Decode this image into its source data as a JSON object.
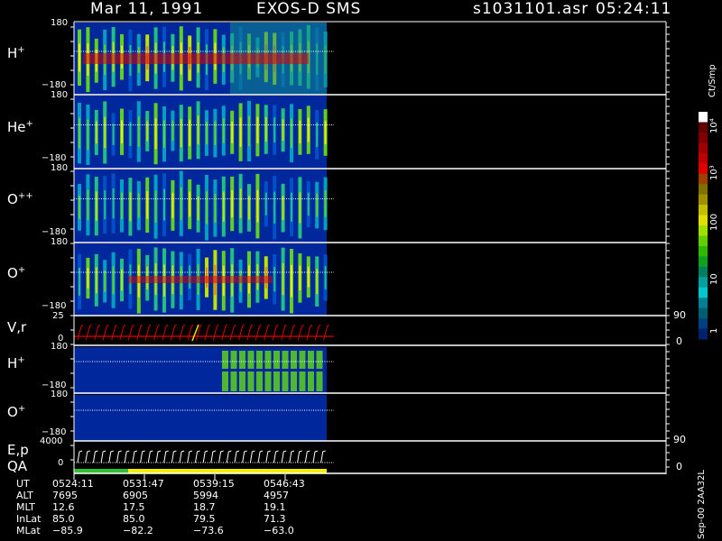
{
  "header": {
    "date": "Mar 11, 1991",
    "instrument": "EXOS-D SMS",
    "filename": "s1031101.asr",
    "time": "05:24:11"
  },
  "panels": [
    {
      "id": "h_plus",
      "label": "H",
      "charge": "+",
      "ymax": "180",
      "ymin": "−180"
    },
    {
      "id": "he_plus",
      "label": "He",
      "charge": "+",
      "ymax": "180",
      "ymin": "−180"
    },
    {
      "id": "o_plusplus",
      "label": "O",
      "charge": "++",
      "ymax": "180",
      "ymin": "−180"
    },
    {
      "id": "o_plus",
      "label": "O",
      "charge": "+",
      "ymax": "180",
      "ymin": "−180"
    },
    {
      "id": "vr",
      "label": "V,r",
      "charge": "",
      "ymax": "25",
      "ymin": "0",
      "rmax": "90",
      "rmin": "0"
    },
    {
      "id": "h_plus_2",
      "label": "H",
      "charge": "+",
      "ymax": "180",
      "ymin": "−180"
    },
    {
      "id": "o_plus_2",
      "label": "O",
      "charge": "+",
      "ymax": "180",
      "ymin": "−180",
      "rmax": "90"
    },
    {
      "id": "ep",
      "label": "E,p",
      "charge": "",
      "ymax": "4000",
      "ymin": "0",
      "rmin": "0"
    },
    {
      "id": "qa",
      "label": "QA",
      "charge": ""
    }
  ],
  "colorbar": {
    "unit": "Ct/Smp",
    "ticks": [
      "10⁴",
      "10³",
      "100",
      "10",
      "1"
    ]
  },
  "footer": {
    "rows": [
      {
        "label": "UT",
        "values": [
          "0524:11",
          "0531:47",
          "0539:15",
          "0546:43"
        ]
      },
      {
        "label": "ALT",
        "values": [
          "7695",
          "6905",
          "5994",
          "4957"
        ]
      },
      {
        "label": "MLT",
        "values": [
          "12.6",
          "17.5",
          "18.7",
          "19.1"
        ]
      },
      {
        "label": "InLat",
        "values": [
          "85.0",
          "85.0",
          "79.5",
          "71.3"
        ]
      },
      {
        "label": "MLat",
        "values": [
          "−85.9",
          "−82.2",
          "−73.6",
          "−63.0"
        ]
      }
    ],
    "side_note": "Sep-00 2AA32L"
  },
  "colors": {
    "background": "#000000",
    "low": "#00289c",
    "mid": "#00c8a0",
    "green": "#40c020",
    "yellow": "#f0e800",
    "red": "#e00000",
    "qa_green": "#30c030",
    "qa_yellow": "#f0f000"
  }
}
